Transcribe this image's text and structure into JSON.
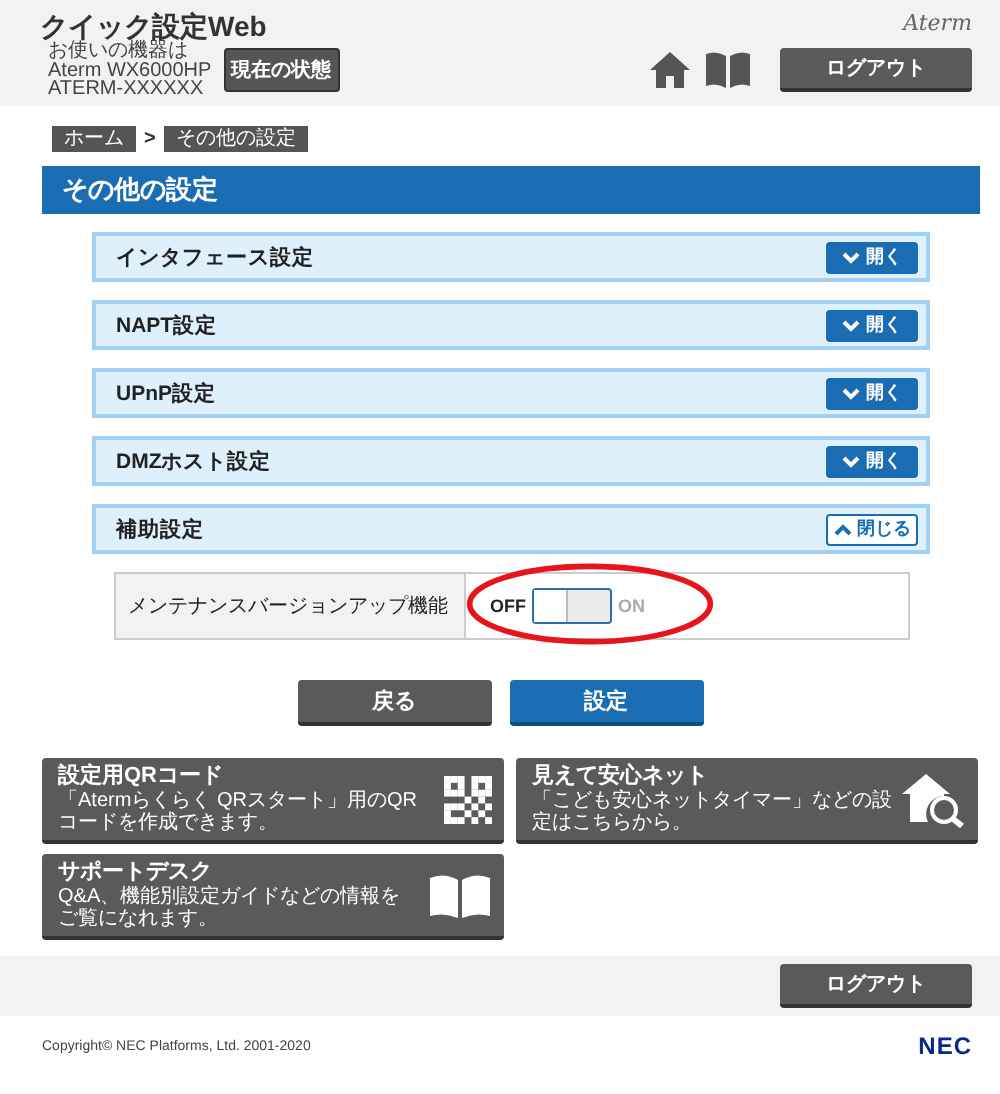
{
  "header": {
    "title": "クイック設定Web",
    "device_lines": [
      "お使いの機器は",
      "Aterm WX6000HP",
      "ATERM-XXXXXX"
    ],
    "status_button": "現在の状態",
    "brand": "Aterm",
    "logout": "ログアウト"
  },
  "breadcrumb": {
    "items": [
      "ホーム",
      "その他の設定"
    ],
    "separator": ">"
  },
  "section_title": "その他の設定",
  "panels": [
    {
      "title": "インタフェース設定",
      "expanded": false,
      "toggle_label": "開く"
    },
    {
      "title": "NAPT設定",
      "expanded": false,
      "toggle_label": "開く"
    },
    {
      "title": "UPnP設定",
      "expanded": false,
      "toggle_label": "開く"
    },
    {
      "title": "DMZホスト設定",
      "expanded": false,
      "toggle_label": "開く"
    },
    {
      "title": "補助設定",
      "expanded": true,
      "toggle_label": "閉じる"
    }
  ],
  "settings": [
    {
      "label": "メンテナンスバージョンアップ機能",
      "off_label": "OFF",
      "on_label": "ON",
      "on": false
    }
  ],
  "buttons": {
    "back": "戻る",
    "apply": "設定"
  },
  "cards": [
    {
      "kind": "qr",
      "title": "設定用QRコード",
      "description": "「Atermらくらく QRスタート」用のQRコードを作成できます。"
    },
    {
      "kind": "house-search",
      "title": "見えて安心ネット",
      "description": "「こども安心ネットタイマー」などの設定はこちらから。"
    },
    {
      "kind": "book",
      "title": "サポートデスク",
      "description": "Q&A、機能別設定ガイドなどの情報をご覧になれます。"
    }
  ],
  "footer": {
    "logout": "ログアウト",
    "copyright": "Copyright© NEC Platforms, Ltd. 2001-2020",
    "logo": "NEC"
  }
}
